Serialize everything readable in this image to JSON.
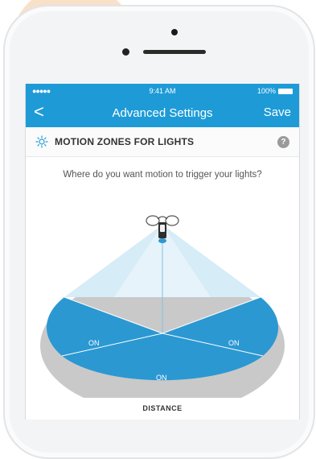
{
  "status_bar": {
    "signal": "●●●●●",
    "time": "9:41 AM",
    "battery": "100%"
  },
  "nav": {
    "back_icon": "chevron-left-icon",
    "back_glyph": "<",
    "title": "Advanced Settings",
    "save_label": "Save"
  },
  "section": {
    "icon": "sun-icon",
    "title": "MOTION ZONES FOR LIGHTS",
    "help_glyph": "?"
  },
  "question": "Where do you want motion to trigger your lights?",
  "zones": [
    {
      "label": "ON"
    },
    {
      "label": "ON"
    },
    {
      "label": "ON"
    }
  ],
  "distance_label": "DISTANCE",
  "colors": {
    "accent": "#1e9bd7",
    "zone_on": "#2b98d2",
    "zone_off": "#c9c9c9",
    "cone": "#cfe8f5"
  }
}
